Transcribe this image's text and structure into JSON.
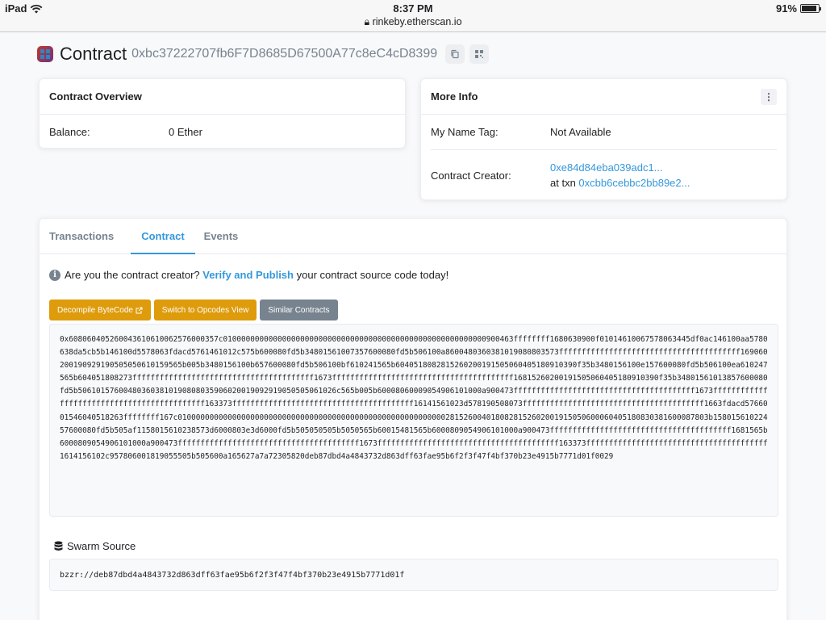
{
  "statusbar": {
    "device": "iPad",
    "time": "8:37 PM",
    "url": "rinkeby.etherscan.io",
    "battery": "91%",
    "battery_level": 0.91
  },
  "header": {
    "title": "Contract",
    "address": "0xbc37222707fb6F7D8685D67500A77c8eC4cD8399"
  },
  "overview": {
    "title": "Contract Overview",
    "balance_label": "Balance:",
    "balance_value": "0 Ether"
  },
  "more_info": {
    "title": "More Info",
    "name_tag_label": "My Name Tag:",
    "name_tag_value": "Not Available",
    "creator_label": "Contract Creator:",
    "creator_address": "0xe84d84eba039adc1...",
    "at_txn_label": "at txn",
    "creator_txn": "0xcbb6cebbc2bb89e2..."
  },
  "tabs": [
    {
      "label": "Transactions",
      "active": false
    },
    {
      "label": "Contract",
      "active": true
    },
    {
      "label": "Events",
      "active": false
    }
  ],
  "notice": {
    "prefix": "Are you the contract creator?",
    "link": "Verify and Publish",
    "suffix": "your contract source code today!"
  },
  "buttons": {
    "decompile": "Decompile ByteCode",
    "opcodes": "Switch to Opcodes View",
    "similar": "Similar Contracts"
  },
  "bytecode": "0x6080604052600436106100625760003 57c0100000000000000000000000000000000000000000000000000000000900463ffffffff1680630900f0101461006757 8063445df0ac146100aa5780638da5cb5b146100d5578063fdacd5761461012c575b600080fd5b348015610073576000 80fd5b506100a86004803603810190808035 73ffffffffffffffffffffffffffffffffffffffff169060200190929190505050610159565b005b3480156100b657600080fd5b506100bf610241565b6040518082 81526020019150506040518091039 0f35b3480156100e157600080fd5b506100ea610247565b6040518082 73ffffffffffffffffffffffffffffffffffffffff1673 ffffffffffffffffffffffffffffffffffffffff168152602001915050604051809103 90f35b348015610138576000 80fd5b506101576004803603810190808035906020019092919050505061026c565b005b6000806000905490610100 0a900473ffffffffffffffffffffffffffffffffffffffff1673ffffffffffffffffffffffffffffffffffffffffffff163373ffffffffffffffffffffffffffffffffffffffff16141561023d578190508073ffffffffffffffffffffffffffffffffffffffff1663fdacd576600154604051826 3ffffffff167c0100000000000000000000000000000000000000000000000000000000028152600401808281526020019150506000604051808303816000 87803b158015610224576000 80fd5b505af1158015610238573d6000803e3d6000fd5b505050505b5050565b60015481565b6000809054906101000a900473ffffffffffffffffffffffffffffffffffffffff1681565b60008090549061010 00a900473ffffffffffffffffffffffffffffffffffffffff1673ffffffffffffffffffffffffffffffffffffffff163373ffffffffffffffffffffffffffffffffffffffff1614156102c9578060018190555 05b505600a165627a7a7230582 0deb87dbd4a4843732d863dff63fae95b6f2f3f47f4bf370b23e4915b7771d01f0029",
  "swarm": {
    "title": "Swarm Source",
    "value": "bzzr://deb87dbd4a4843732d863dff63fae95b6f2f3f47f4bf370b23e4915b7771d01f"
  }
}
